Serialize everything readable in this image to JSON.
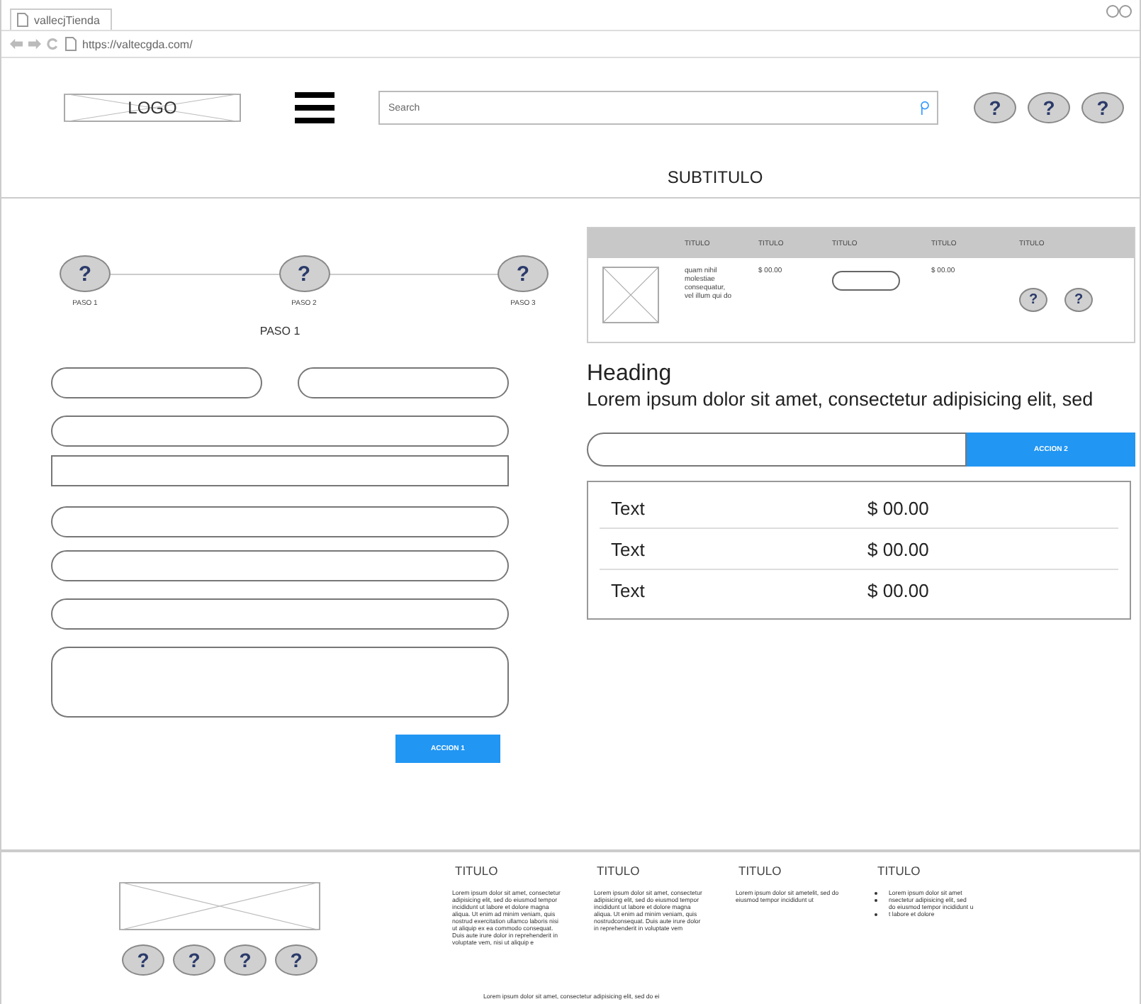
{
  "browser": {
    "tab_title": "vallecjTienda",
    "url": "https://valtecgda.com/"
  },
  "header": {
    "logo": "LOGO",
    "search": {
      "placeholder": "Search"
    },
    "icon_buttons": [
      "?",
      "?",
      "?"
    ]
  },
  "subtitle": "SUBTITULO",
  "stepper": {
    "steps": [
      {
        "icon": "?",
        "label": "PASO 1"
      },
      {
        "icon": "?",
        "label": "PASO 2"
      },
      {
        "icon": "?",
        "label": "PASO 3"
      }
    ],
    "current_label": "PASO 1"
  },
  "form": {
    "rows": [
      {
        "fields": [
          {
            "kind": "pill"
          },
          {
            "kind": "pill"
          }
        ]
      },
      {
        "fields": [
          {
            "kind": "pill"
          }
        ]
      },
      {
        "fields": [
          {
            "kind": "box"
          }
        ]
      },
      {
        "fields": [
          {
            "kind": "pill"
          }
        ]
      },
      {
        "fields": [
          {
            "kind": "pill"
          }
        ]
      },
      {
        "fields": [
          {
            "kind": "pill"
          }
        ]
      },
      {
        "fields": [
          {
            "kind": "textarea"
          }
        ]
      }
    ],
    "button": "ACCION 1"
  },
  "table": {
    "columns": [
      "TITULO",
      "TITULO",
      "TITULO",
      "TITULO",
      "TITULO"
    ],
    "rows": [
      {
        "description": "quam nihil molestiae consequatur, vel illum qui do",
        "price": "$ 00.00",
        "total": "$ 00.00",
        "actions": [
          "?",
          "?"
        ]
      }
    ]
  },
  "heading": "Heading",
  "lead": "Lorem ipsum dolor sit amet, consectetur adipisicing elit, sed",
  "action_button": "ACCION 2",
  "price_list": [
    {
      "label": "Text",
      "value": "$ 00.00"
    },
    {
      "label": "Text",
      "value": "$ 00.00"
    },
    {
      "label": "Text",
      "value": "$ 00.00"
    }
  ],
  "footer": {
    "icon_buttons": [
      "?",
      "?",
      "?",
      "?"
    ],
    "columns": [
      {
        "title": "TITULO",
        "text": "Lorem ipsum dolor sit amet, consectetur adipisicing elit, sed do eiusmod tempor incididunt ut labore et dolore magna aliqua. Ut enim ad minim veniam, quis nostrud exercitation ullamco laboris nisi ut aliquip ex ea commodo consequat. Duis aute irure dolor in reprehenderit in voluptate vem, nisi ut aliquip e"
      },
      {
        "title": "TITULO",
        "text": "Lorem ipsum dolor sit amet, consectetur adipisicing elit, sed do eiusmod tempor incididunt ut labore et dolore magna aliqua. Ut enim ad minim veniam, quis nostrudconsequat. Duis aute irure dolor in reprehenderit in voluptate vem"
      },
      {
        "title": "TITULO",
        "text": "Lorem ipsum dolor sit ametelit, sed do eiusmod tempor incididunt ut"
      },
      {
        "title": "TITULO",
        "items": [
          "Lorem ipsum dolor sit amet",
          "nsectetur adipisicing elit, sed do eiusmod tempor incididunt u",
          "t labore et dolore"
        ]
      }
    ],
    "bottom_text": "Lorem ipsum dolor sit amet, consectetur adipisicing elit, sed do ei"
  }
}
